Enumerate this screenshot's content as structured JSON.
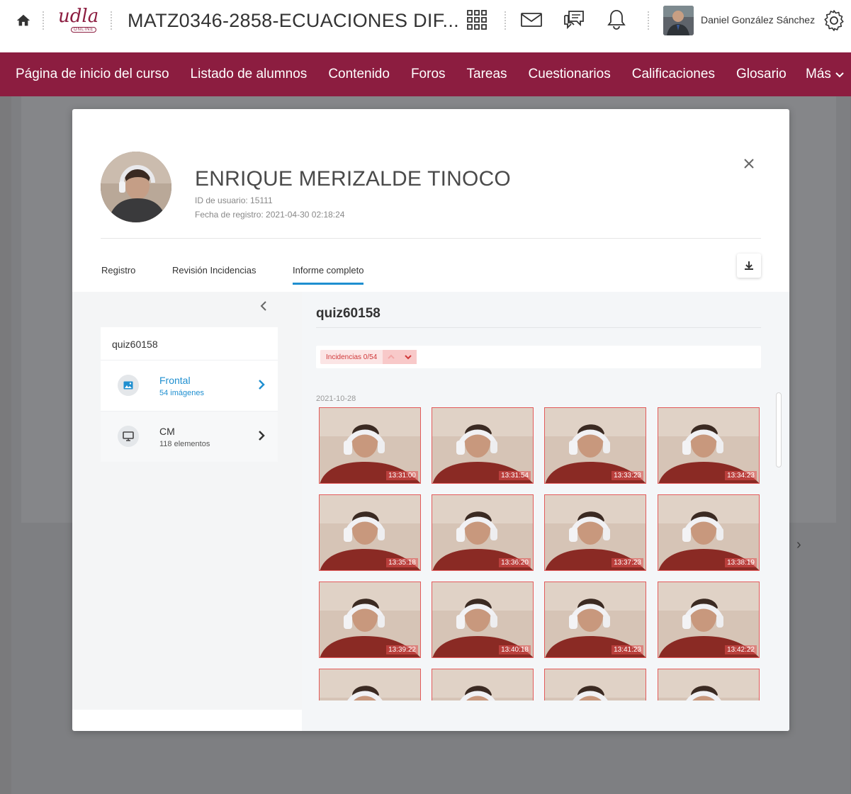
{
  "header": {
    "course_title": "MATZ0346-2858-ECUACIONES DIF...",
    "logo_text": "udla",
    "logo_sub": "ONLINE",
    "user_name": "Daniel González Sánchez"
  },
  "nav": {
    "items": [
      "Página de inicio del curso",
      "Listado de alumnos",
      "Contenido",
      "Foros",
      "Tareas",
      "Cuestionarios",
      "Calificaciones",
      "Glosario"
    ],
    "more_label": "Más"
  },
  "modal": {
    "student_name": "ENRIQUE MERIZALDE TINOCO",
    "user_id": "ID de usuario: 15111",
    "registration": "Fecha de registro: 2021-04-30 02:18:24",
    "tabs": [
      "Registro",
      "Revisión Incidencias",
      "Informe completo"
    ],
    "active_tab": "Informe completo",
    "left": {
      "quiz": "quiz60158",
      "sources": [
        {
          "name": "Frontal",
          "count": "54 imágenes",
          "active": true
        },
        {
          "name": "CM",
          "count": "118 elementos",
          "active": false
        }
      ]
    },
    "right": {
      "quiz_title": "quiz60158",
      "incidencias": "Incidencias 0/54",
      "date": "2021-10-28",
      "thumbnails": [
        "13:31:00",
        "13:31:54",
        "13:33:23",
        "13:34:23",
        "13:35:18",
        "13:36:20",
        "13:37:23",
        "13:38:19",
        "13:39:22",
        "13:40:18",
        "13:41:23",
        "13:42:22",
        "",
        "",
        "",
        ""
      ]
    }
  },
  "colors": {
    "brand": "#8c1d40",
    "accent": "#1f8fd0",
    "incident": "#e35b5b"
  },
  "icons": [
    "home-icon",
    "apps-grid-icon",
    "mail-icon",
    "chat-icon",
    "bell-icon",
    "gear-icon",
    "close-icon",
    "download-icon",
    "chevron-left-icon",
    "chevron-right-icon",
    "image-icon",
    "monitor-icon",
    "chevron-up-icon",
    "chevron-down-icon"
  ]
}
